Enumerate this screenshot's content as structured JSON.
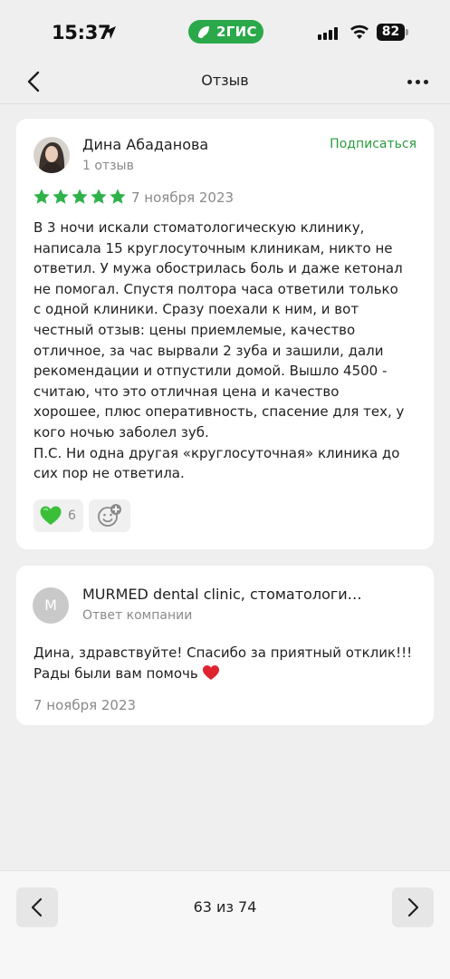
{
  "status_bar": {
    "time": "15:37",
    "app_badge": "2ГИС",
    "battery": "82"
  },
  "nav": {
    "title": "Отзыв"
  },
  "review": {
    "author": "Дина Абаданова",
    "review_count": "1 отзыв",
    "subscribe_label": "Подписаться",
    "rating": 5,
    "date": "7 ноября 2023",
    "text": "В 3 ночи искали стоматологическую клинику,\nнаписала 15 круглосуточным клиникам, никто не\nответил. У мужа обострилась боль и даже кетонал\nне помогал. Спустя полтора часа ответили только\nс одной клиники. Сразу поехали к ним, и вот\nчестный отзыв: цены приемлемые, качество\nотличное, за час вырвали 2 зуба и зашили, дали\nрекомендации и отпустили домой. Вышло 4500 -\nсчитаю, что это отличная цена и качество\nхорошее, плюс оперативность, спасение для тех, у\nкого ночью заболел зуб.\nП.С. Ни одна другая «круглосуточная» клиника до\nсих пор не ответила.",
    "reactions": {
      "heart_count": "6"
    }
  },
  "reply": {
    "avatar_letter": "M",
    "company": "MURMED dental clinic, стоматологи…",
    "role": "Ответ компании",
    "text": "Дина, здравствуйте! Спасибо за приятный отклик!!! Рады были вам помочь",
    "date": "7 ноября 2023"
  },
  "pagination": {
    "label": "63 из 74"
  },
  "colors": {
    "accent_green": "#2a9d3f",
    "star": "#2fb24a",
    "badge_green": "#2aa84a"
  }
}
